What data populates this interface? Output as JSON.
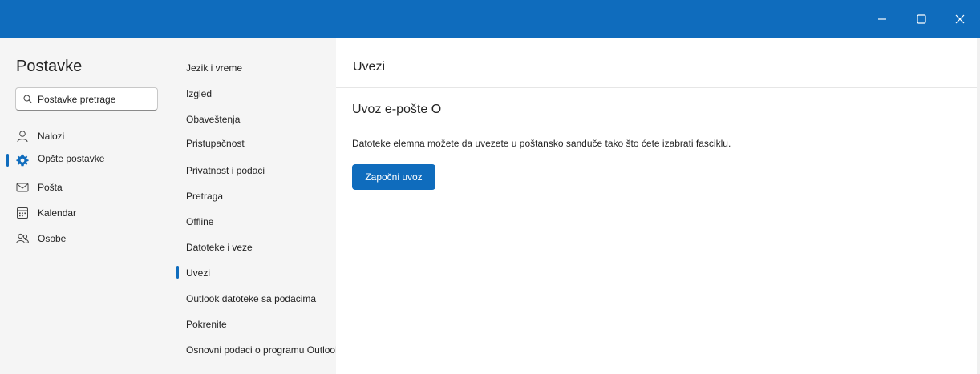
{
  "colors": {
    "accent": "#0f6cbd",
    "pane_bg": "#f5f5f5",
    "text": "#242424"
  },
  "window_controls": [
    {
      "name": "minimize",
      "icon": "minimize-icon"
    },
    {
      "name": "maximize",
      "icon": "maximize-icon"
    },
    {
      "name": "close",
      "icon": "close-icon"
    }
  ],
  "sidebar": {
    "title": "Postavke",
    "search": {
      "placeholder": "Postavke pretrage",
      "value": ""
    },
    "items": [
      {
        "label": "Nalozi",
        "icon": "person-icon",
        "selected": false
      },
      {
        "label": "Opšte postavke",
        "icon": "gear-icon",
        "selected": true
      },
      {
        "label": "Pošta",
        "icon": "mail-icon",
        "selected": false
      },
      {
        "label": "Kalendar",
        "icon": "calendar-icon",
        "selected": false
      },
      {
        "label": "Osobe",
        "icon": "people-icon",
        "selected": false
      }
    ]
  },
  "subnav": {
    "items": [
      {
        "label": "Jezik i vreme",
        "selected": false
      },
      {
        "label": "Izgled",
        "selected": false
      },
      {
        "label": "Obaveštenja",
        "selected": false
      },
      {
        "label": "Pristupačnost",
        "selected": false
      },
      {
        "label": "Privatnost i podaci",
        "selected": false
      },
      {
        "label": "Pretraga",
        "selected": false
      },
      {
        "label": "Offline",
        "selected": false
      },
      {
        "label": "Datoteke i veze",
        "selected": false
      },
      {
        "label": "Uvezi",
        "selected": true
      },
      {
        "label": "Outlook datoteke sa podacima",
        "selected": false
      },
      {
        "label": "Pokrenite",
        "selected": false
      },
      {
        "label": "Osnovni podaci o programu Outlook",
        "selected": false
      }
    ]
  },
  "main": {
    "title": "Uvezi",
    "section_title": "Uvoz e-pošte O",
    "description": "Datoteke elemna možete da uvezete u poštansko sanduče tako što ćete izabrati fasciklu.",
    "button_label": "Započni uvoz"
  }
}
